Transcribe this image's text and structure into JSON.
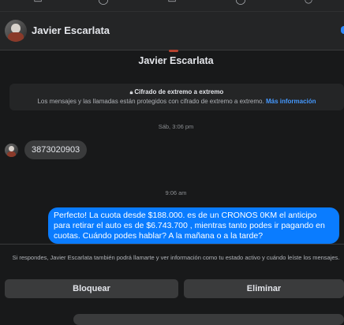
{
  "header": {
    "contact_name": "Javier Escarlata"
  },
  "profile": {
    "name": "Javier Escarlata"
  },
  "encryption": {
    "title": "Cifrado de extremo a extremo",
    "body": "Los mensajes y las llamadas están protegidos con cifrado de extremo a extremo.",
    "link": "Más información"
  },
  "messages": [
    {
      "timestamp": "Sáb, 3:06 pm",
      "direction": "incoming",
      "text": "3873020903"
    },
    {
      "timestamp": "9:06 am",
      "direction": "outgoing",
      "text": "Perfecto! La cuota desde $188.000. es de un CRONOS 0KM el anticipo para retirar el auto es de $6.743.700 , mientras tanto podes ir pagando en cuotas. Cuándo podes hablar? A la mañana o a la tarde?"
    }
  ],
  "footer": {
    "notice": "Si respondes, Javier Escarlata también podrá llamarte y ver información como tu estado activo y cuándo leíste los mensajes.",
    "block_label": "Bloquear",
    "delete_label": "Eliminar"
  },
  "icons": [
    "home-icon",
    "messenger-icon",
    "marketplace-icon",
    "profile-icon",
    "notifications-icon",
    "lock-icon"
  ],
  "colors": {
    "accent": "#0a7cff",
    "link": "#4599ff",
    "background": "#18191a"
  }
}
